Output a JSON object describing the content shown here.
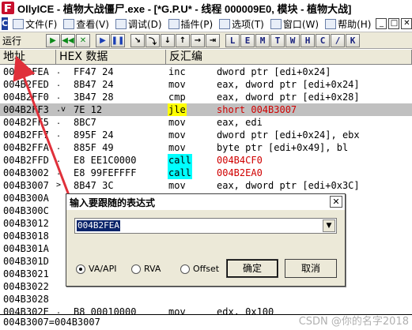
{
  "window": {
    "title": "OllyICE - 植物大战僵尸.exe - [*G.P.U* - 线程 000009E0, 模块 - 植物大战]"
  },
  "menu": {
    "items": [
      {
        "label": "文件(F)",
        "icon": "file-icon"
      },
      {
        "label": "查看(V)",
        "icon": "view-icon"
      },
      {
        "label": "调试(D)",
        "icon": "debug-icon"
      },
      {
        "label": "插件(P)",
        "icon": "plugin-icon"
      },
      {
        "label": "选项(T)",
        "icon": "options-icon"
      },
      {
        "label": "窗口(W)",
        "icon": "window-icon"
      },
      {
        "label": "帮助(H)",
        "icon": "help-icon"
      }
    ],
    "system_glyph": "C",
    "window_controls": [
      "_",
      "□",
      "✕"
    ]
  },
  "toolbar": {
    "state_label": "运行",
    "buttons": [
      "▶",
      "◀◀",
      "✕",
      "▶",
      "❚❚",
      "↘",
      "⤵",
      "↓",
      "↑",
      "→",
      "⇥"
    ],
    "letters": [
      "L",
      "E",
      "M",
      "T",
      "W",
      "H",
      "C",
      "/",
      "K"
    ]
  },
  "columns": {
    "address": "地址",
    "hex": "HEX 数据",
    "disasm": "反汇编"
  },
  "rows": [
    {
      "addr": "004B2FEA",
      "arrow": ".",
      "hex": "FF47 24",
      "mn": "inc",
      "op": "dword ptr [edi+0x24]",
      "kind": ""
    },
    {
      "addr": "004B2FED",
      "arrow": ".",
      "hex": "8B47 24",
      "mn": "mov",
      "op": "eax, dword ptr [edi+0x24]",
      "kind": ""
    },
    {
      "addr": "004B2FF0",
      "arrow": ".",
      "hex": "3B47 28",
      "mn": "cmp",
      "op": "eax, dword ptr [edi+0x28]",
      "kind": ""
    },
    {
      "addr": "004B2FF3",
      "arrow": ".v",
      "hex": "7E 12",
      "mn": "jle",
      "op": "short 004B3007",
      "kind": "jump",
      "selected": true
    },
    {
      "addr": "004B2FF5",
      "arrow": ".",
      "hex": "8BC7",
      "mn": "mov",
      "op": "eax, edi",
      "kind": ""
    },
    {
      "addr": "004B2FF7",
      "arrow": ".",
      "hex": "895F 24",
      "mn": "mov",
      "op": "dword ptr [edi+0x24], ebx",
      "kind": ""
    },
    {
      "addr": "004B2FFA",
      "arrow": ".",
      "hex": "885F 49",
      "mn": "mov",
      "op": "byte ptr [edi+0x49], bl",
      "kind": ""
    },
    {
      "addr": "004B2FFD",
      "arrow": ".",
      "hex": "E8 EE1C0000",
      "mn": "call",
      "op": "004B4CF0",
      "kind": "call"
    },
    {
      "addr": "004B3002",
      "arrow": ".",
      "hex": "E8 99FEFFFF",
      "mn": "call",
      "op": "004B2EA0",
      "kind": "call"
    },
    {
      "addr": "004B3007",
      "arrow": ">",
      "hex": "8B47 3C",
      "mn": "mov",
      "op": "eax, dword ptr [edi+0x3C]",
      "kind": ""
    },
    {
      "addr": "004B300A",
      "arrow": "",
      "hex": "",
      "mn": "",
      "op": "",
      "kind": ""
    },
    {
      "addr": "004B300C",
      "arrow": "",
      "hex": "",
      "mn": "",
      "op": "",
      "kind": ""
    },
    {
      "addr": "004B3012",
      "arrow": "",
      "hex": "",
      "mn": "",
      "op": "",
      "kind": ""
    },
    {
      "addr": "004B3018",
      "arrow": "",
      "hex": "",
      "mn": "",
      "op": "",
      "kind": ""
    },
    {
      "addr": "004B301A",
      "arrow": "",
      "hex": "",
      "mn": "",
      "op": "",
      "kind": ""
    },
    {
      "addr": "004B301D",
      "arrow": "",
      "hex": "",
      "mn": "",
      "op": "",
      "kind": ""
    },
    {
      "addr": "004B3021",
      "arrow": "",
      "hex": "",
      "mn": "",
      "op": "",
      "kind": ""
    },
    {
      "addr": "004B3022",
      "arrow": "",
      "hex": "",
      "mn": "",
      "op": "",
      "kind": ""
    },
    {
      "addr": "004B3028",
      "arrow": "",
      "hex": "",
      "mn": "",
      "op": "",
      "kind": ""
    },
    {
      "addr": "004B302E",
      "arrow": ".",
      "hex": "B8 00010000",
      "mn": "mov",
      "op": "edx, 0x100",
      "kind": ""
    }
  ],
  "status": {
    "text": "004B3007=004B3007"
  },
  "watermark": "CSDN @你的名字2018",
  "dialog": {
    "title": "输入要跟随的表达式",
    "close": "✕",
    "expression": "004B2FEA",
    "options": [
      {
        "label": "VA/API",
        "checked": true
      },
      {
        "label": "RVA",
        "checked": false
      },
      {
        "label": "Offset",
        "checked": false
      }
    ],
    "ok_label": "确定",
    "cancel_label": "取消"
  },
  "colors": {
    "jump_highlight": "#ffff00",
    "call_highlight": "#00ffff",
    "target_text": "#d00000",
    "selection": "#c0c0c0",
    "annotation_arrow": "#e0303a"
  }
}
